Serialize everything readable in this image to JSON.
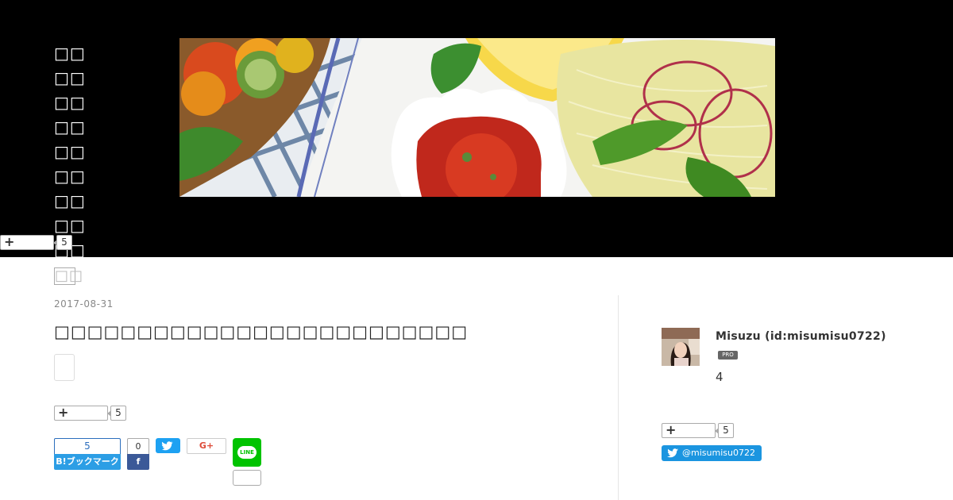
{
  "header": {
    "title_line_count": 10,
    "image_alt": "Salad platter header image"
  },
  "entry": {
    "date": "2017-08-31"
  },
  "stars": {
    "header_count": "5",
    "entry_count": "5",
    "sidebar_count": "5"
  },
  "share": {
    "hatena_count": "5",
    "hatena_label": "B!ブックマーク",
    "facebook_count": "0",
    "facebook_label": "f",
    "googleplus_label": "G+",
    "line_label": "LINE"
  },
  "profile": {
    "name": "Misuzu (id:misumisu0722)",
    "badge": "PRO",
    "count": "4",
    "twitter_handle": "@misumisu0722"
  },
  "colors": {
    "header_bg": "#000000",
    "hatena_blue": "#2c9ee5",
    "facebook_blue": "#3b5998",
    "twitter_blue": "#1da1f2",
    "line_green": "#00c300"
  }
}
